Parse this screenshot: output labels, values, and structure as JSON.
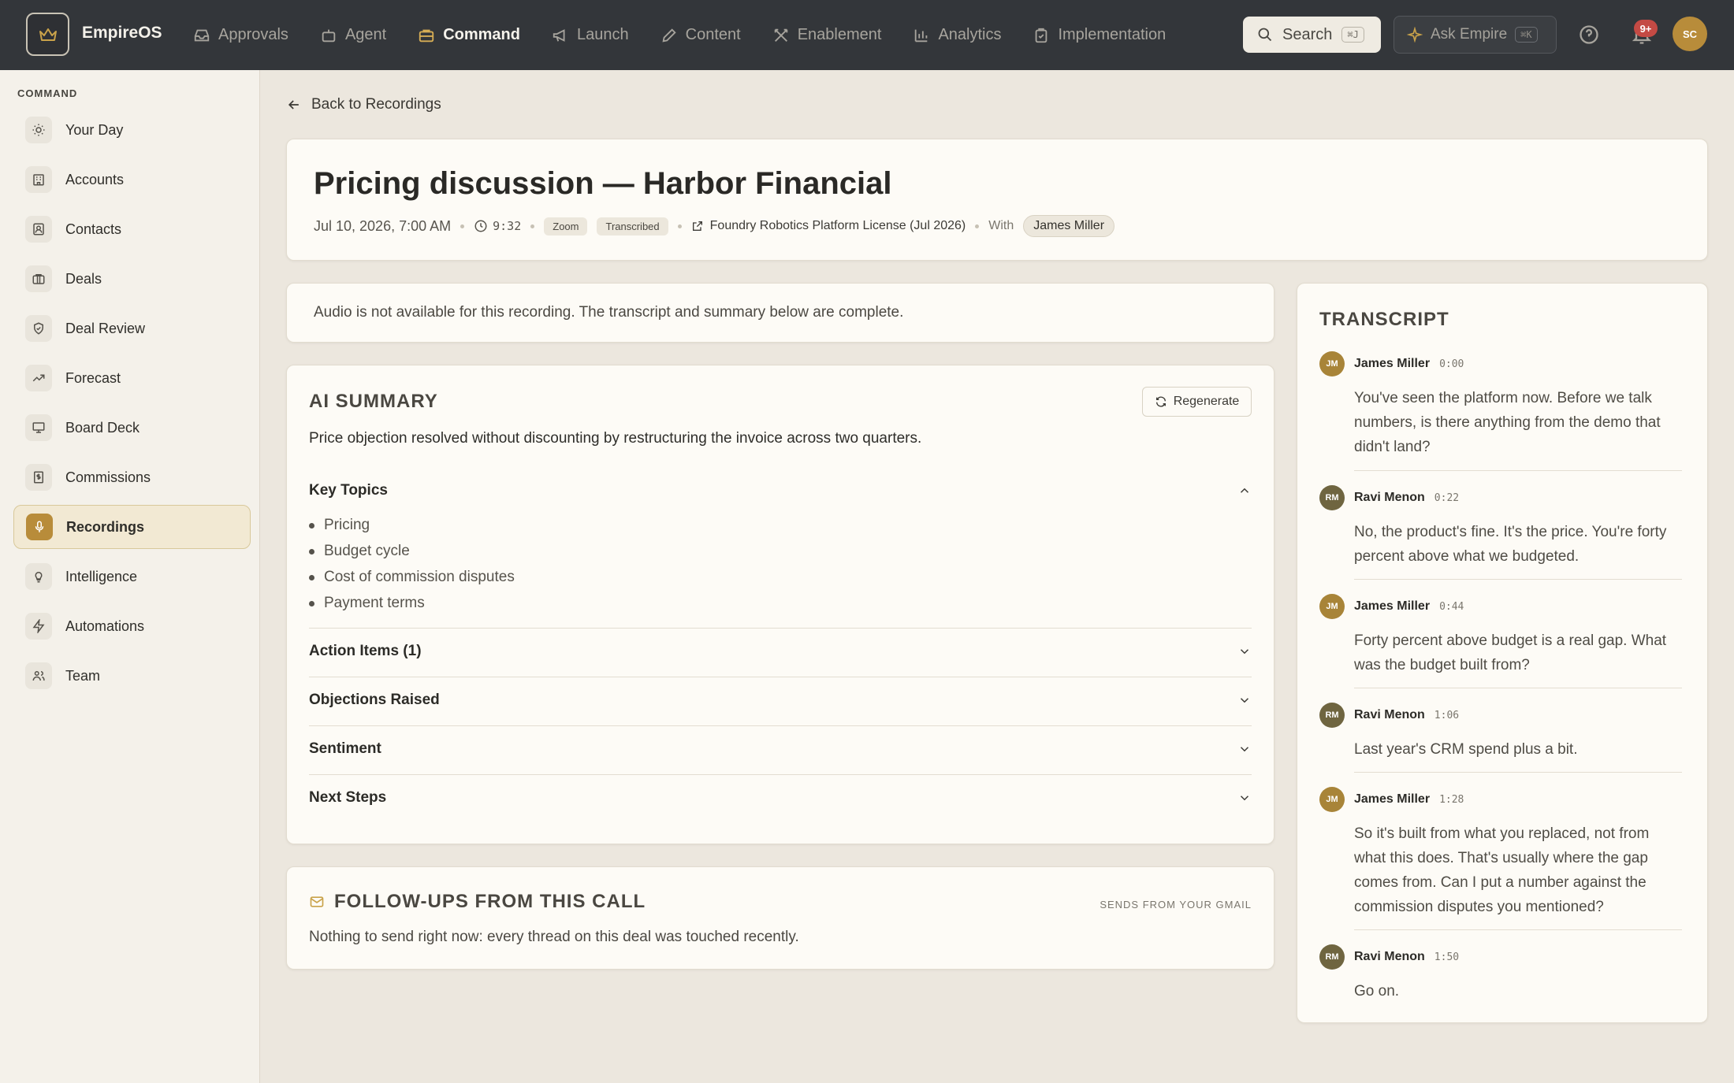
{
  "app": {
    "name": "EmpireOS"
  },
  "nav": [
    {
      "label": "Approvals",
      "icon": "inbox-icon",
      "active": false
    },
    {
      "label": "Agent",
      "icon": "bot-icon",
      "active": false
    },
    {
      "label": "Command",
      "icon": "briefcase-icon",
      "active": true
    },
    {
      "label": "Launch",
      "icon": "megaphone-icon",
      "active": false
    },
    {
      "label": "Content",
      "icon": "pen-icon",
      "active": false
    },
    {
      "label": "Enablement",
      "icon": "swords-icon",
      "active": false
    },
    {
      "label": "Analytics",
      "icon": "bar-chart-icon",
      "active": false
    },
    {
      "label": "Implementation",
      "icon": "clipboard-icon",
      "active": false
    }
  ],
  "topbar": {
    "search_label": "Search",
    "search_shortcut": "⌘J",
    "ask_label": "Ask Empire",
    "ask_shortcut": "⌘K",
    "notif_badge": "9+",
    "avatar_initials": "SC"
  },
  "sidebar": {
    "heading": "COMMAND",
    "items": [
      {
        "label": "Your Day",
        "icon": "sun-icon"
      },
      {
        "label": "Accounts",
        "icon": "building-icon"
      },
      {
        "label": "Contacts",
        "icon": "contact-card-icon"
      },
      {
        "label": "Deals",
        "icon": "briefcase-icon"
      },
      {
        "label": "Deal Review",
        "icon": "shield-check-icon"
      },
      {
        "label": "Forecast",
        "icon": "trending-up-icon"
      },
      {
        "label": "Board Deck",
        "icon": "presentation-icon"
      },
      {
        "label": "Commissions",
        "icon": "receipt-dollar-icon"
      },
      {
        "label": "Recordings",
        "icon": "microphone-icon",
        "active": true
      },
      {
        "label": "Intelligence",
        "icon": "lightbulb-icon"
      },
      {
        "label": "Automations",
        "icon": "zap-icon"
      },
      {
        "label": "Team",
        "icon": "users-icon"
      }
    ]
  },
  "back_label": "Back to Recordings",
  "recording": {
    "title": "Pricing discussion — Harbor Financial",
    "date": "Jul 10, 2026, 7:00 AM",
    "duration": "9:32",
    "source_tag": "Zoom",
    "status_tag": "Transcribed",
    "deal_link": "Foundry Robotics Platform License (Jul 2026)",
    "with_label": "With",
    "with_person": "James Miller"
  },
  "notice": "Audio is not available for this recording. The transcript and summary below are complete.",
  "summary": {
    "title": "AI SUMMARY",
    "regenerate_label": "Regenerate",
    "text": "Price objection resolved without discounting by restructuring the invoice across two quarters.",
    "key_topics_label": "Key Topics",
    "topics": [
      "Pricing",
      "Budget cycle",
      "Cost of commission disputes",
      "Payment terms"
    ],
    "sections": [
      "Action Items (1)",
      "Objections Raised",
      "Sentiment",
      "Next Steps"
    ]
  },
  "followups": {
    "title": "FOLLOW-UPS FROM THIS CALL",
    "subtitle": "SENDS FROM YOUR GMAIL",
    "text": "Nothing to send right now: every thread on this deal was touched recently."
  },
  "transcript": {
    "title": "TRANSCRIPT",
    "entries": [
      {
        "initials": "JM",
        "name": "James Miller",
        "time": "0:00",
        "text": "You've seen the platform now. Before we talk numbers, is there anything from the demo that didn't land?"
      },
      {
        "initials": "RM",
        "name": "Ravi Menon",
        "time": "0:22",
        "text": "No, the product's fine. It's the price. You're forty percent above what we budgeted."
      },
      {
        "initials": "JM",
        "name": "James Miller",
        "time": "0:44",
        "text": "Forty percent above budget is a real gap. What was the budget built from?"
      },
      {
        "initials": "RM",
        "name": "Ravi Menon",
        "time": "1:06",
        "text": "Last year's CRM spend plus a bit."
      },
      {
        "initials": "JM",
        "name": "James Miller",
        "time": "1:28",
        "text": "So it's built from what you replaced, not from what this does. That's usually where the gap comes from. Can I put a number against the commission disputes you mentioned?"
      },
      {
        "initials": "RM",
        "name": "Ravi Menon",
        "time": "1:50",
        "text": "Go on."
      }
    ]
  }
}
